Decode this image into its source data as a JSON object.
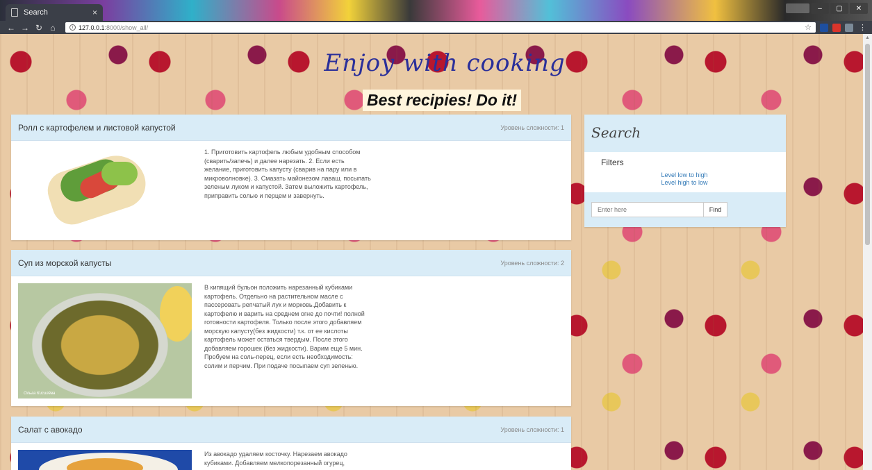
{
  "browser": {
    "tab_title": "Search",
    "tab_close": "×",
    "url_host": "127.0.0.1",
    "url_rest": ":8000/show_all/",
    "window_controls": [
      "–",
      "▢",
      "✕"
    ]
  },
  "site": {
    "title": "Enjoy with cooking",
    "tagline": "Best recipies! Do it!"
  },
  "recipes": [
    {
      "title": "Ролл с картофелем и листовой капустой",
      "level": "Уровень сложности: 1",
      "text": "1. Приготовить картофель любым удобным способом (сварить/запечь) и далее нарезать. 2. Если есть желание, приготовить капусту (сварив на пару или в микроволновке). 3. Смазать майонезом лаваш, посыпать зеленым луком и капустой. Затем выложить картофель, приправить солью и перцем и завернуть."
    },
    {
      "title": "Суп из морской капусты",
      "level": "Уровень сложности: 2",
      "text": "В кипящий бульон положить нарезанный кубиками картофель. Отдельно на растительном масле с пассеровать репчатый лук и морковь.Добавить к картофелю и варить на среднем огне до почти! полной готовности картофеля. Только после этого добавляем морскую капусту(без жидкости) т.к. от ее кислоты картофель может остаться твердым. После этого добавляем горошек (без жидкости). Варим еще 5 мин. Пробуем на соль-перец, если есть необходимость: солим и перчим. При подаче посыпаем суп зеленью.",
      "image_caption": "Ольга Кисилёва"
    },
    {
      "title": "Салат с авокадо",
      "level": "Уровень сложности: 1",
      "text": "Из авокадо удаляем косточку. Нарезаем авокадо кубиками. Добавляем мелкопорезанный огурец,"
    }
  ],
  "search": {
    "heading": "Search",
    "filters_label": "Filters",
    "filter_low_high": "Level low to high",
    "filter_high_low": "Level high to low",
    "input_placeholder": "Enter here",
    "find_label": "Find"
  },
  "colors": {
    "card_header": "#d9ecf7",
    "title_blue": "#2a2f9a",
    "link_blue": "#337ab7"
  }
}
